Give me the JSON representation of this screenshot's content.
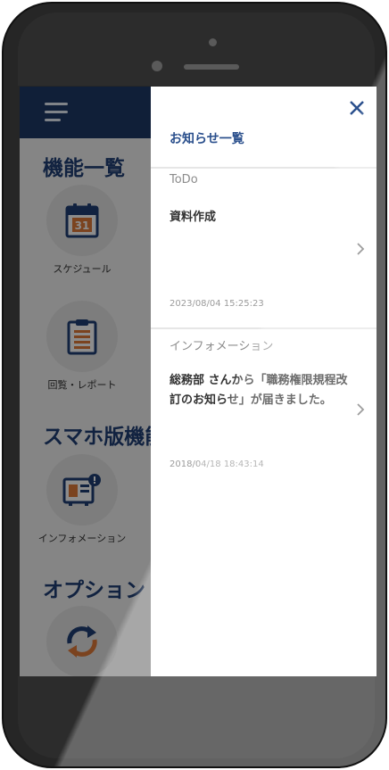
{
  "app": {
    "menu_icon": "hamburger-icon",
    "sections": {
      "features": "機能一覧",
      "smartphone": "スマホ版機能",
      "options": "オプション"
    },
    "features": [
      {
        "label": "スケジュール",
        "icon": "calendar-icon",
        "calendar_day": "31"
      },
      {
        "label": "回覧・レポート",
        "icon": "clipboard-icon"
      },
      {
        "label": "インフォメーション",
        "icon": "information-icon"
      },
      {
        "label": "",
        "icon": "sync-icon"
      }
    ]
  },
  "drawer": {
    "title": "お知らせ一覧",
    "close_icon": "close-icon",
    "groups": [
      {
        "category": "ToDo",
        "items": [
          {
            "text": "資料作成",
            "time": "2023/08/04 15:25:23"
          }
        ]
      },
      {
        "category": "インフォメーション",
        "items": [
          {
            "text": "総務部 さんから「職務権限規程改訂のお知らせ」が届きました。",
            "time": "2018/04/18 18:43:14"
          }
        ]
      }
    ]
  },
  "colors": {
    "header": "#1e3a66",
    "accent": "#2a4f8c",
    "icon_orange": "#e07a3a",
    "phone_body": "#262626"
  }
}
